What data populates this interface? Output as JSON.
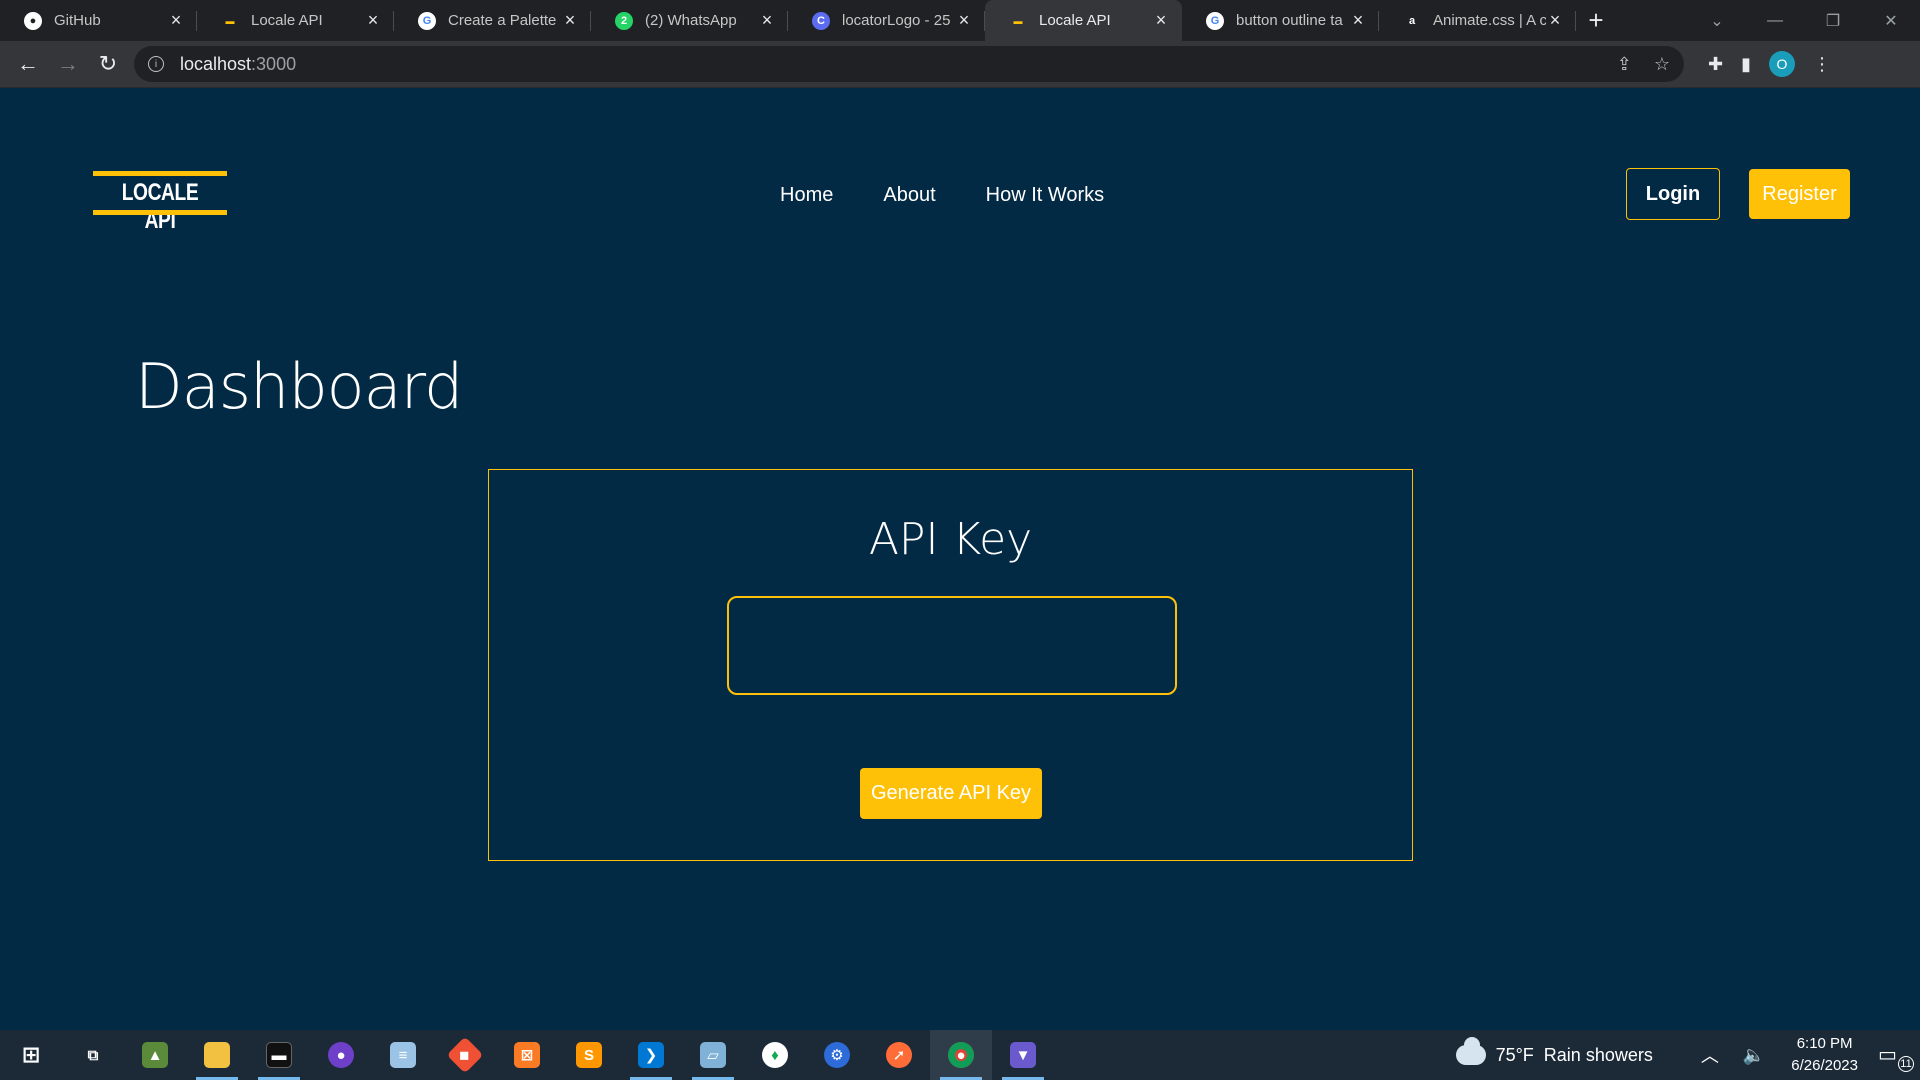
{
  "browser": {
    "tabs": [
      {
        "title": "GitHub",
        "icon": "github-icon",
        "active": false
      },
      {
        "title": "Locale API",
        "icon": "locale-api-favicon",
        "active": false
      },
      {
        "title": "Create a Palette",
        "icon": "google-icon",
        "active": false
      },
      {
        "title": "(2) WhatsApp",
        "icon": "whatsapp-icon",
        "active": false
      },
      {
        "title": "locatorLogo - 25",
        "icon": "canva-icon",
        "active": false
      },
      {
        "title": "Locale API",
        "icon": "locale-api-favicon",
        "active": true
      },
      {
        "title": "button outline ta",
        "icon": "google-icon",
        "active": false
      },
      {
        "title": "Animate.css | A c",
        "icon": "animate-icon",
        "active": false
      }
    ],
    "url_host": "localhost",
    "url_port": ":3000",
    "profile_initial": "O"
  },
  "site": {
    "logo_text": "LOCALE API",
    "nav": {
      "home": "Home",
      "about": "About",
      "how_it_works": "How It Works"
    },
    "login_label": "Login",
    "register_label": "Register"
  },
  "dashboard": {
    "title": "Dashboard",
    "card_title": "API Key",
    "api_key_value": "",
    "generate_label": "Generate API Key"
  },
  "taskbar": {
    "weather_temp": "75°F",
    "weather_desc": "Rain showers",
    "time": "6:10 PM",
    "date": "6/26/2023",
    "notification_count": "11"
  },
  "colors": {
    "page_bg": "#032a44",
    "accent": "#ffc107"
  }
}
